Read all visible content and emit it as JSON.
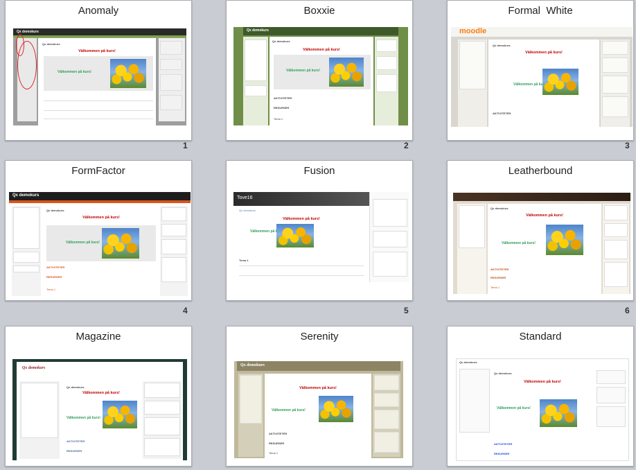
{
  "course": {
    "name": "Qx demokurs",
    "welcome": "Välkommen på kurs!",
    "activities": "AKTIVITETER",
    "resources": "RESURSER",
    "topic": "Tema 1",
    "site_name": "Tove16",
    "moodle_logo": "moodle"
  },
  "slides": [
    {
      "title": "Anomaly",
      "number": "1"
    },
    {
      "title": "Boxxie",
      "number": "2"
    },
    {
      "title": "Formal  White",
      "number": "3"
    },
    {
      "title": "FormFactor",
      "number": "4"
    },
    {
      "title": "Fusion",
      "number": "5"
    },
    {
      "title": "Leatherbound",
      "number": "6"
    },
    {
      "title": "Magazine",
      "number": ""
    },
    {
      "title": "Serenity",
      "number": ""
    },
    {
      "title": "Standard",
      "number": ""
    }
  ],
  "colors": {
    "background": "#c9ccd2",
    "welcome_red": "#c00000",
    "welcome_green": "#2f9e5a",
    "annotation_red": "#e02020"
  }
}
